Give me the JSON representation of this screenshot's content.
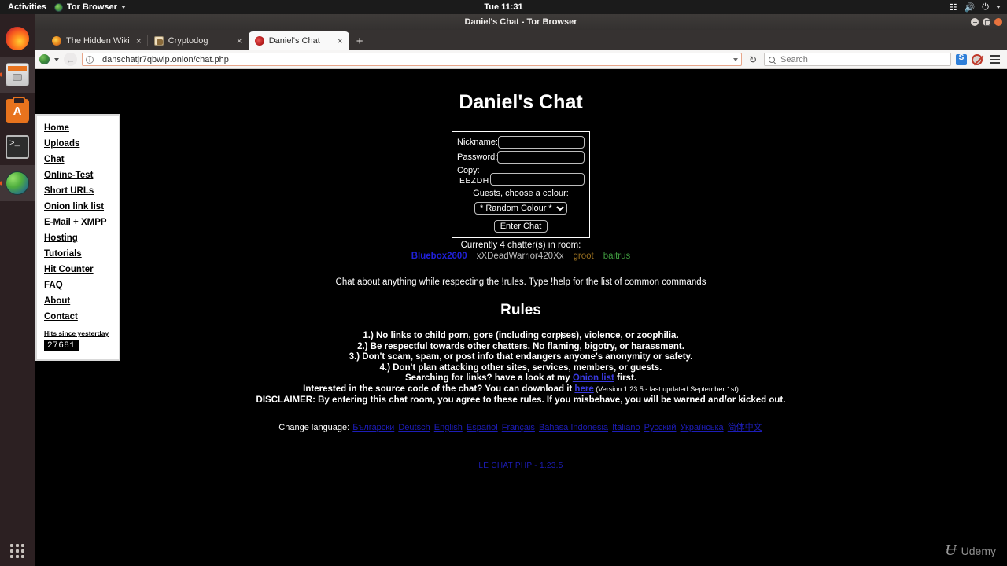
{
  "desktop": {
    "activities": "Activities",
    "app_menu": "Tor Browser",
    "clock": "Tue 11:31",
    "dock": [
      {
        "name": "firefox",
        "label": "Firefox"
      },
      {
        "name": "files",
        "label": "Files"
      },
      {
        "name": "software",
        "label": "Ubuntu Software"
      },
      {
        "name": "terminal",
        "label": "Terminal"
      },
      {
        "name": "tor-browser",
        "label": "Tor Browser"
      }
    ]
  },
  "window": {
    "title": "Daniel's Chat - Tor Browser"
  },
  "tabs": [
    {
      "label": "The Hidden Wiki",
      "favicon": "wiki-icon",
      "active": false,
      "close": "×"
    },
    {
      "label": "Cryptodog",
      "favicon": "cryptodog-icon",
      "active": false,
      "close": "×"
    },
    {
      "label": "Daniel's Chat",
      "favicon": "raspberry-icon",
      "active": true,
      "close": "×"
    }
  ],
  "new_tab_label": "+",
  "toolbar": {
    "url": "danschatjr7qbwip.onion/chat.php",
    "search_placeholder": "Search",
    "reload_glyph": "↻",
    "back_glyph": "←"
  },
  "sidebar": {
    "items": [
      {
        "label": "Home"
      },
      {
        "label": "Uploads"
      },
      {
        "label": "Chat"
      },
      {
        "label": "Online-Test"
      },
      {
        "label": "Short URLs"
      },
      {
        "label": "Onion link list"
      },
      {
        "label": "E-Mail + XMPP"
      },
      {
        "label": "Hosting"
      },
      {
        "label": "Tutorials"
      },
      {
        "label": "Hit Counter"
      },
      {
        "label": "FAQ"
      },
      {
        "label": "About"
      },
      {
        "label": "Contact"
      }
    ],
    "hits_label": "Hits since yesterday",
    "hits_count": "27681"
  },
  "main": {
    "title": "Daniel's Chat",
    "form": {
      "nickname_label": "Nickname:",
      "nickname_value": "",
      "password_label": "Password:",
      "password_value": "",
      "copy_label": "Copy:",
      "captcha_code": "EEZDH",
      "captcha_value": "",
      "colour_label": "Guests, choose a colour:",
      "colour_selected": "* Random Colour *",
      "colour_options": [
        "* Random Colour *"
      ],
      "enter_button": "Enter Chat"
    },
    "chatters_count_text": "Currently 4 chatter(s) in room:",
    "chatters": [
      {
        "name": "Bluebox2600",
        "color": "#2020d8"
      },
      {
        "name": "xXDeadWarrior420Xx",
        "color": "#bdbdbd"
      },
      {
        "name": "groot",
        "color": "#9a7020"
      },
      {
        "name": "baitrus",
        "color": "#3f9a3f"
      }
    ],
    "description": "Chat about anything while respecting the !rules. Type !help for the list of common commands",
    "rules_title": "Rules",
    "rules": [
      "1.) No links to child porn, gore (including corpses), violence, or zoophilia.",
      "2.) Be respectful towards other chatters. No flaming, bigotry, or harassment.",
      "3.) Don't scam, spam, or post info that endangers anyone's anonymity or safety.",
      "4.) Don't plan attacking other sites, services, members, or guests."
    ],
    "search_links_pre": "Searching for links? have a look at my ",
    "search_links_anchor": "Onion list",
    "search_links_post": " first.",
    "source_pre": "Interested in the source code of the chat? You can download it ",
    "source_anchor": "here",
    "source_version": " (Version 1.23.5 - last updated September 1st)",
    "disclaimer": "DISCLAIMER: By entering this chat room, you agree to these rules. If you misbehave, you will be warned and/or kicked out.",
    "language_label": "Change language:",
    "languages": [
      "Български",
      "Deutsch",
      "English",
      "Español",
      "Français",
      "Bahasa Indonesia",
      "Italiano",
      "Русский",
      "Українська",
      "简体中文"
    ],
    "footer_link": "LE CHAT PHP - 1.23.5"
  },
  "watermark": {
    "brand": "Udemy",
    "glyph": "Ʉ"
  },
  "colors": {
    "page_background": "#000000",
    "link": "#1d1db8",
    "accent": "#e95420"
  }
}
